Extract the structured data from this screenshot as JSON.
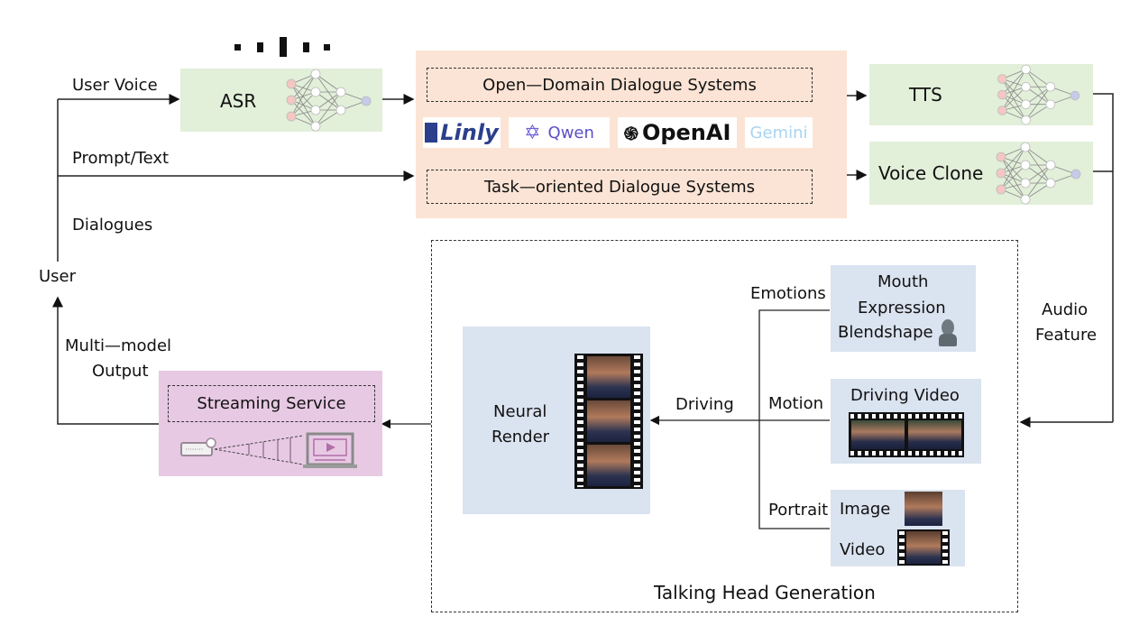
{
  "diagram": {
    "title": "Talking Head Generation",
    "user": {
      "label": "User",
      "inputs": [
        "User Voice",
        "Prompt/Text",
        "Dialogues"
      ],
      "output_label_line1": "Multi—model",
      "output_label_line2": "Output"
    },
    "asr": {
      "label": "ASR",
      "icon": "neural-network-icon",
      "audio_icon": "waveform-bars-icon"
    },
    "dialogue": {
      "open_domain": "Open—Domain Dialogue Systems",
      "task_oriented": "Task—oriented Dialogue Systems",
      "logos": [
        "Linly",
        "Qwen",
        "OpenAI",
        "Gemini"
      ]
    },
    "tts": {
      "label": "TTS"
    },
    "voice_clone": {
      "label": "Voice Clone"
    },
    "audio_feature": {
      "line1": "Audio",
      "line2": "Feature"
    },
    "talking_head": {
      "title": "Talking Head Generation",
      "neural_render": {
        "line1": "Neural",
        "line2": "Render"
      },
      "driving_label": "Driving",
      "branches": [
        {
          "label": "Emotions",
          "box_lines": [
            "Mouth",
            "Expression",
            "Blendshape"
          ]
        },
        {
          "label": "Motion",
          "box_title": "Driving Video"
        },
        {
          "label": "Portrait",
          "items": [
            "Image",
            "Video"
          ]
        }
      ]
    },
    "streaming": {
      "label": "Streaming Service"
    },
    "colors": {
      "green_box": "#e2efd9",
      "peach_box": "#fbe4d5",
      "blue_box": "#dae3f0",
      "pink_box": "#e8c9e4",
      "node_red": "#f4c7c3",
      "node_blue": "#c5cbe9"
    }
  }
}
